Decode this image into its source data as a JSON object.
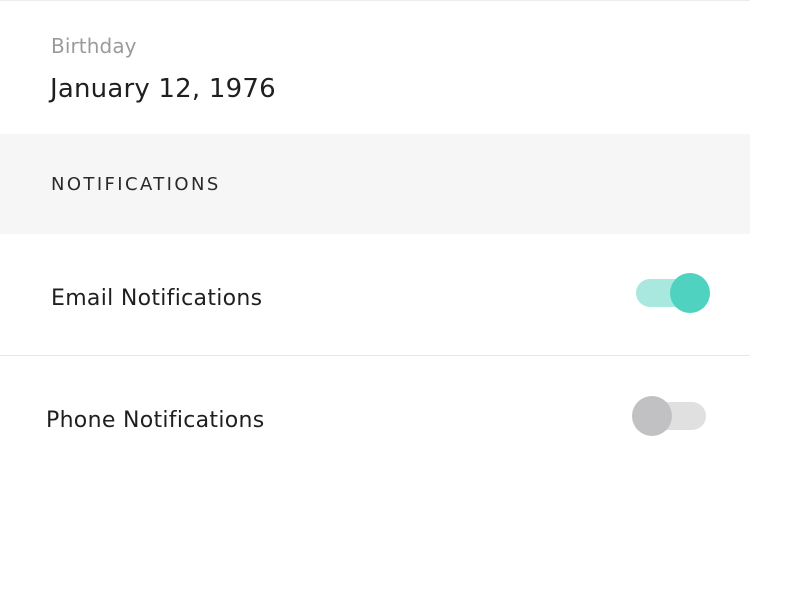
{
  "profile": {
    "birthday_label": "Birthday",
    "birthday_value": "January 12, 1976"
  },
  "notifications": {
    "section_title": "NOTIFICATIONS",
    "email": {
      "label": "Email Notifications",
      "enabled": true
    },
    "phone": {
      "label": "Phone Notifications",
      "enabled": false
    }
  },
  "colors": {
    "toggle_on_track": "#a8e8df",
    "toggle_on_knob": "#4fd2bf",
    "toggle_off_track": "#e0e0e0",
    "toggle_off_knob": "#c1c1c4"
  }
}
